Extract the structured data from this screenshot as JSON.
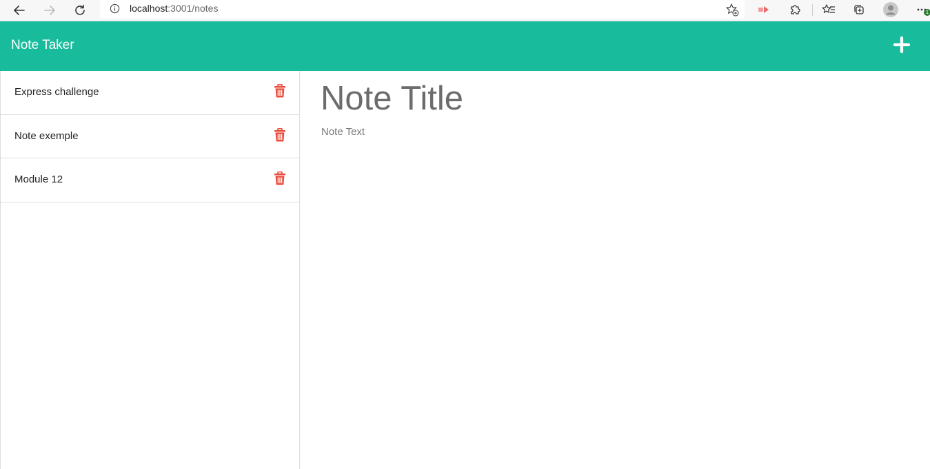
{
  "browser": {
    "url_host": "localhost",
    "url_path": ":3001/notes",
    "update_badge": "1"
  },
  "header": {
    "title": "Note Taker",
    "new_note_icon": "plus-icon"
  },
  "notes": [
    {
      "title": "Express challenge"
    },
    {
      "title": "Note exemple"
    },
    {
      "title": "Module 12"
    }
  ],
  "editor": {
    "title_placeholder": "Note Title",
    "text_placeholder": "Note Text"
  },
  "colors": {
    "header_bg": "#18bc9c",
    "delete_icon": "#e74c3c",
    "placeholder": "#6c6c6c"
  }
}
